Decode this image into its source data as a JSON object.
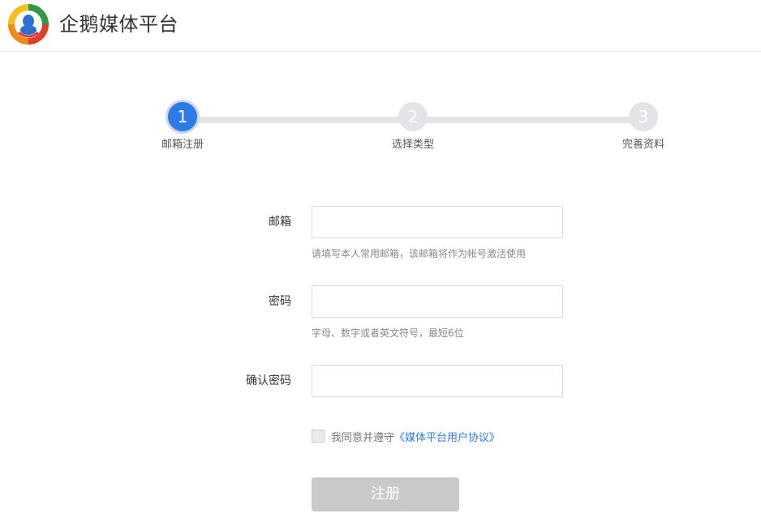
{
  "header": {
    "title": "企鹅媒体平台",
    "logo_icon": "tencent-penguin-logo-icon"
  },
  "steps": [
    {
      "number": "1",
      "label": "邮箱注册",
      "active": true
    },
    {
      "number": "2",
      "label": "选择类型",
      "active": false
    },
    {
      "number": "3",
      "label": "完善资料",
      "active": false
    }
  ],
  "form": {
    "email": {
      "label": "邮箱",
      "value": "",
      "placeholder": "",
      "hint": "请填写本人常用邮箱，该邮箱将作为帐号激活使用"
    },
    "password": {
      "label": "密码",
      "value": "",
      "placeholder": "",
      "hint": "字母、数字或者英文符号，最短6位"
    },
    "confirm_password": {
      "label": "确认密码",
      "value": "",
      "placeholder": ""
    },
    "agreement": {
      "checked": false,
      "text": "我同意并遵守",
      "link_text": "《媒体平台用户协议》"
    },
    "submit_label": "注册"
  },
  "colors": {
    "accent": "#2b7ce9",
    "step_inactive": "#e3e3e8",
    "button_disabled": "#c9c9c9"
  }
}
